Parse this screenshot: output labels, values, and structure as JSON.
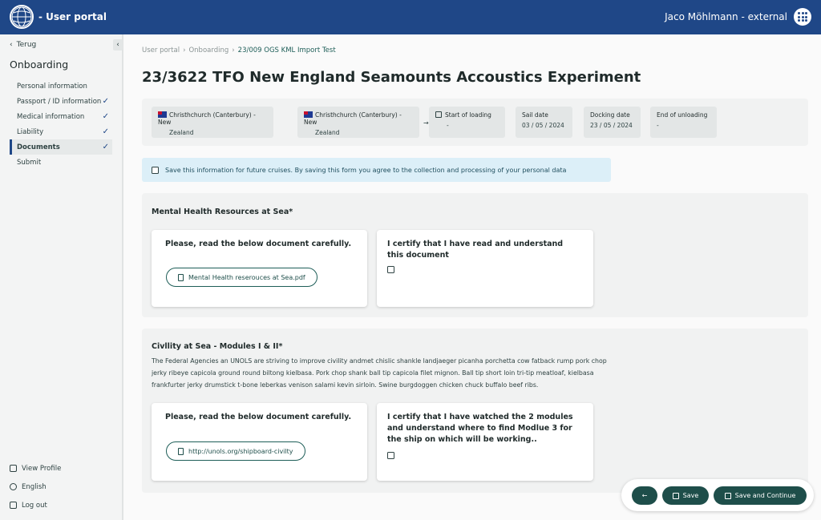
{
  "header": {
    "app_title": "- User portal",
    "user_name": "Jaco Möhlmann - external"
  },
  "sidebar": {
    "back_label": "Terug",
    "title": "Onboarding",
    "items": [
      {
        "label": "Personal information",
        "done": false
      },
      {
        "label": "Passport / ID information",
        "done": true
      },
      {
        "label": "Medical information",
        "done": true
      },
      {
        "label": "Liability",
        "done": true
      },
      {
        "label": "Documents",
        "done": true
      },
      {
        "label": "Submit",
        "done": false
      }
    ],
    "footer": {
      "profile": "View Profile",
      "language": "English",
      "logout": "Log out"
    }
  },
  "breadcrumb": [
    "User portal",
    "Onboarding",
    "23/009 OGS KML Import Test"
  ],
  "page_title": "23/3622 TFO New England Seamounts Accoustics Experiment",
  "trip": {
    "departure_line1": "Christhchurch (Canterbury) - New",
    "departure_line2": "Zealand",
    "arrival_line1": "Christhchurch (Canterbury) - New",
    "arrival_line2": "Zealand",
    "start_loading_label": "Start of loading",
    "start_loading_value": "-",
    "sail_date_label": "Sail date",
    "sail_date_value": "03 / 05 / 2024",
    "docking_date_label": "Docking date",
    "docking_date_value": "23 / 05 / 2024",
    "end_unloading_label": "End of unloading",
    "end_unloading_value": "-"
  },
  "consent_text": "Save this information for future cruises. By saving this form you agree to the collection and processing of your personal data",
  "section1": {
    "title": "Mental Health Resources at Sea*",
    "read_title": "Please, read the below document carefully.",
    "doc_label": "Mental Health reserouces at Sea.pdf",
    "certify_title": "I certify that I have read and understand this document"
  },
  "section2": {
    "title": "Civllity at Sea - Modules I & II*",
    "description": "The Federal Agencies an UNOLS are striving to improve civility andmet chislic shankle landjaeger picanha porchetta cow fatback rump pork chop jerky ribeye capicola ground round biltong kielbasa. Pork chop shank ball tip capicola filet mignon. Ball tip short loin tri-tip meatloaf, kielbasa frankfurter jerky drumstick t-bone leberkas venison salami kevin sirloin. Swine burgdoggen chicken chuck buffalo beef ribs.",
    "read_title": "Please, read the below document carefully.",
    "link_label": "http://unols.org/shipboard-civilty",
    "certify_title": "I certify that I have watched the 2 modules and understand where to find Modlue 3 for the ship on which will be working.."
  },
  "actions": {
    "back_glyph": "←",
    "save_label": "Save",
    "save_continue_label": "Save and Continue"
  },
  "colors": {
    "header_bg": "#1f4787",
    "accent": "#1e4e4a",
    "consent_bg": "#dceff8"
  }
}
